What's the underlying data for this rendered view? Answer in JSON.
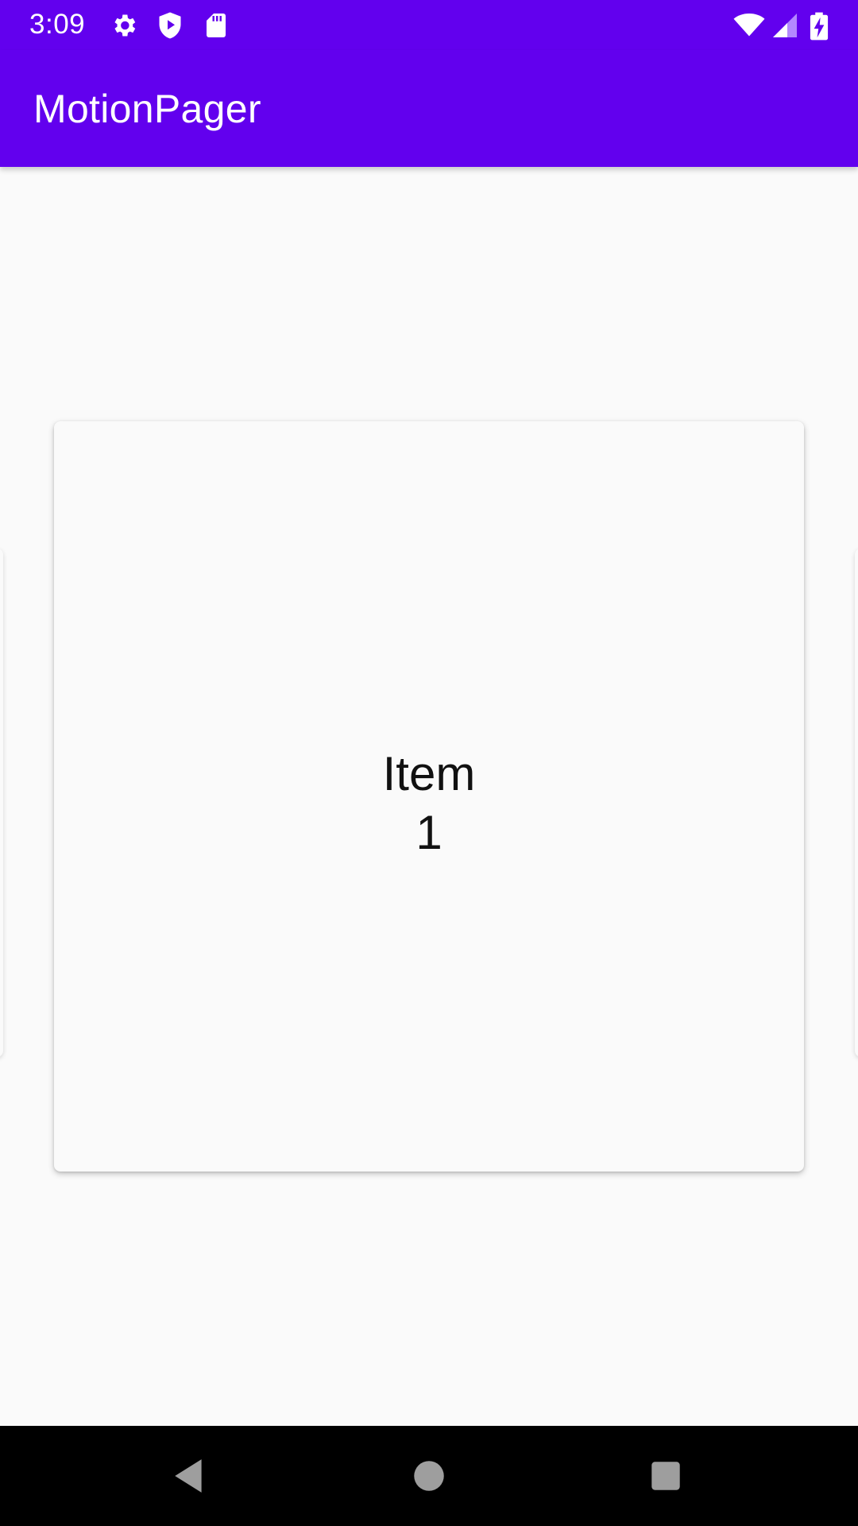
{
  "status_bar": {
    "time": "3:09",
    "left_icons": [
      "settings-icon",
      "shield-play-icon",
      "sd-card-icon"
    ],
    "right_icons": [
      "wifi-icon",
      "signal-icon",
      "battery-charging-icon"
    ]
  },
  "app_bar": {
    "title": "MotionPager"
  },
  "pager": {
    "current_item_label": "Item",
    "current_item_number": "1"
  },
  "nav_bar": {
    "buttons": [
      "back-icon",
      "home-icon",
      "recents-icon"
    ]
  },
  "colors": {
    "primary": "#6200ee",
    "background": "#fafafa",
    "nav_bar": "#000000"
  }
}
